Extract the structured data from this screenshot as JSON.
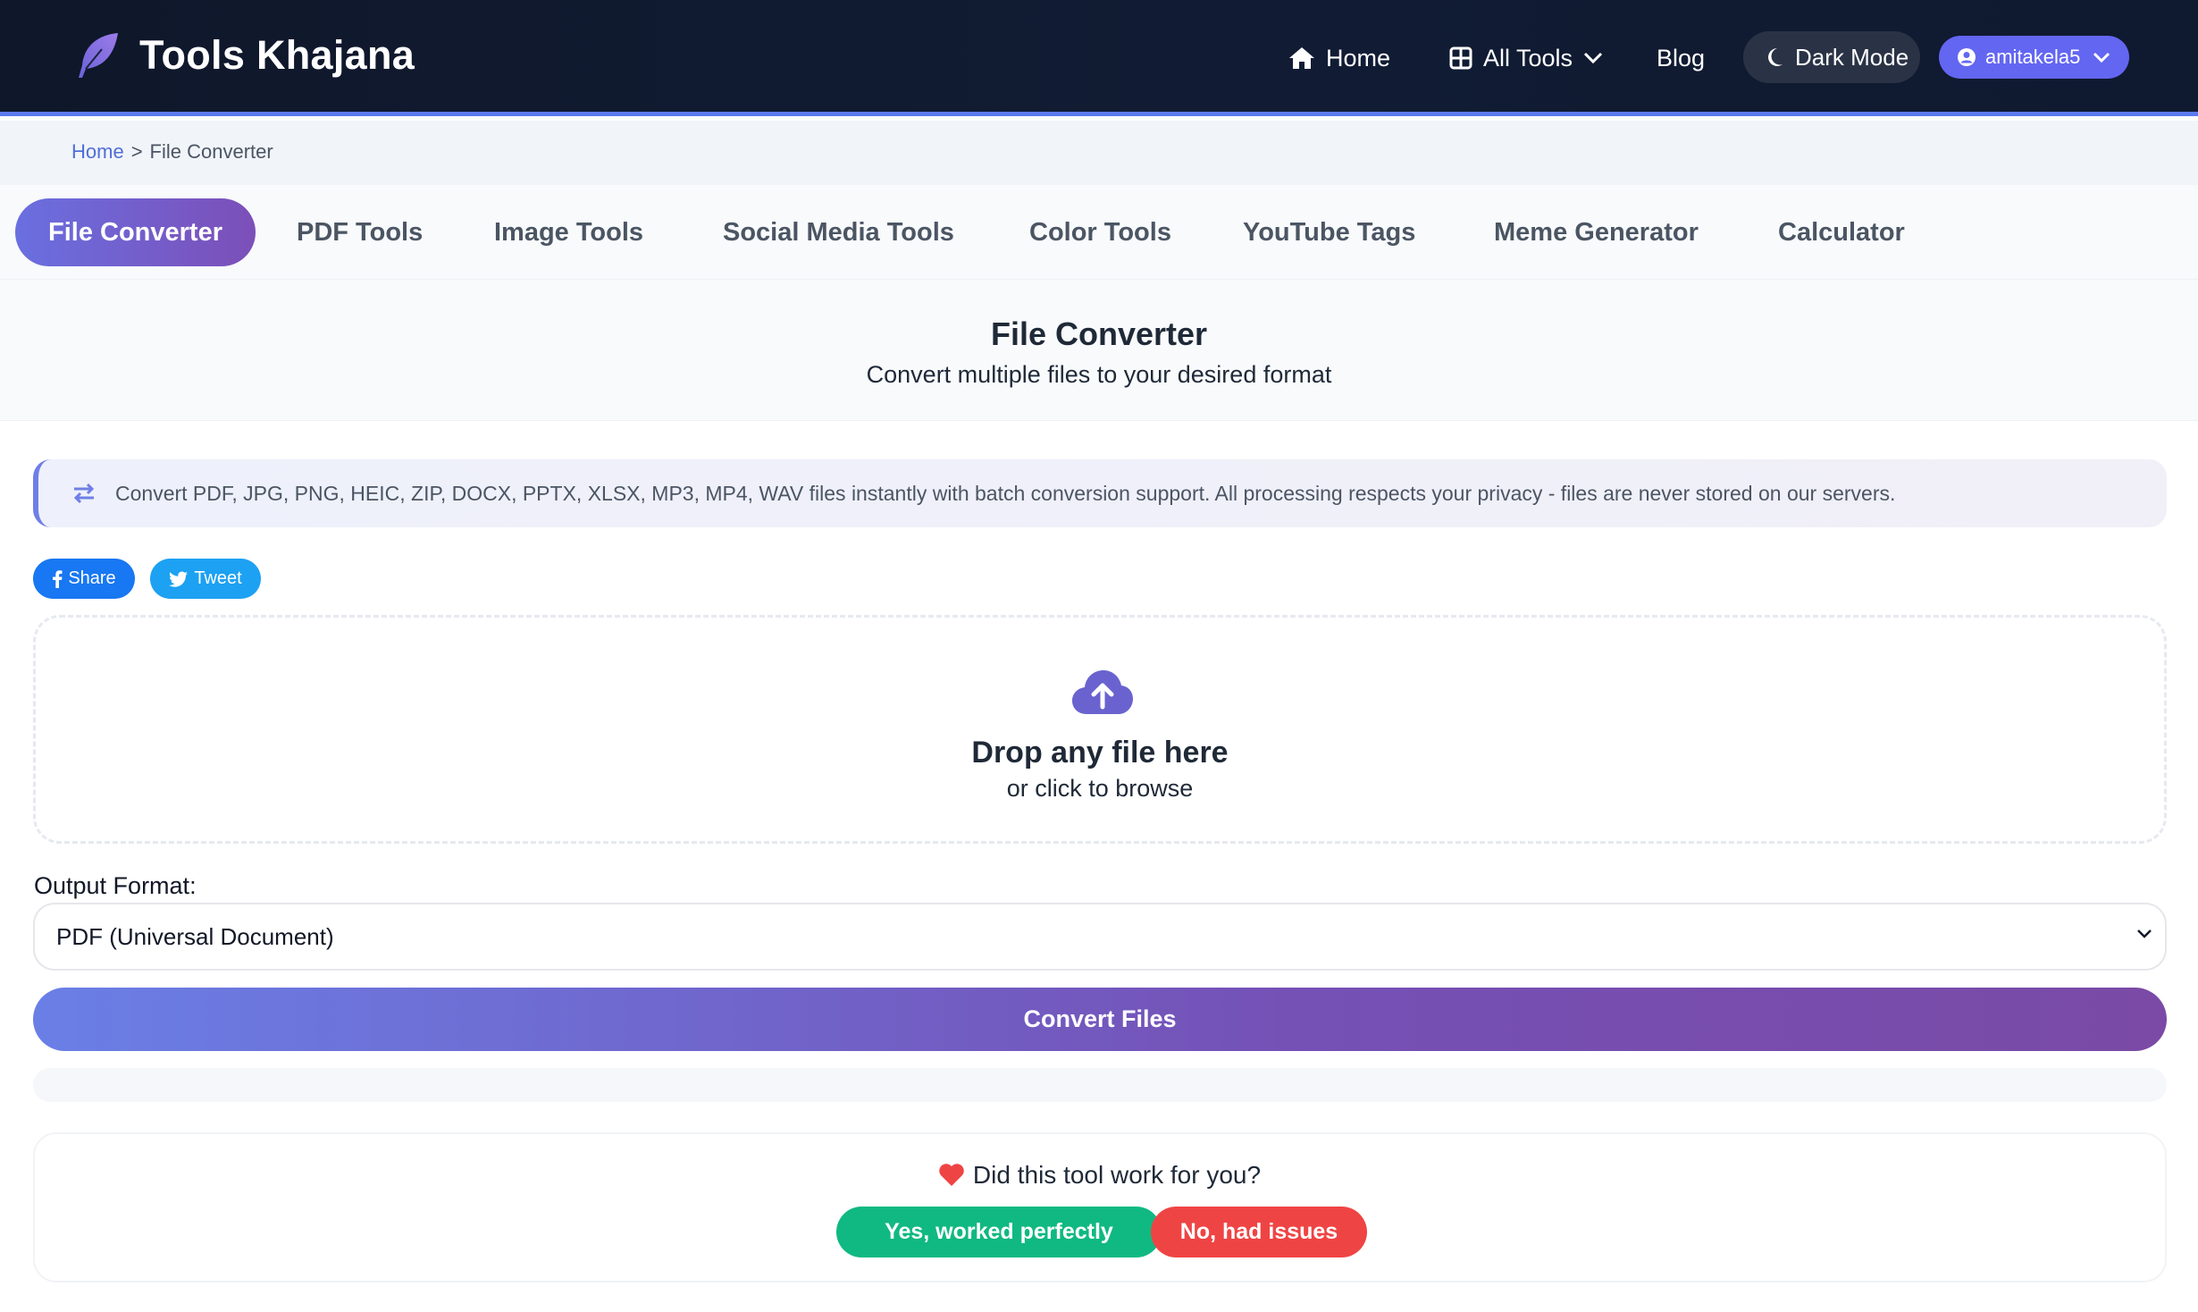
{
  "header": {
    "brand": "Tools Khajana",
    "nav": {
      "home": "Home",
      "all_tools": "All Tools",
      "blog": "Blog"
    },
    "dark_mode": "Dark Mode",
    "user": "amitakela5"
  },
  "breadcrumb": {
    "home": "Home",
    "separator": ">",
    "current": "File Converter"
  },
  "tabs": [
    {
      "label": "File Converter",
      "active": true
    },
    {
      "label": "PDF Tools"
    },
    {
      "label": "Image Tools"
    },
    {
      "label": "Social Media Tools"
    },
    {
      "label": "Color Tools"
    },
    {
      "label": "YouTube Tags"
    },
    {
      "label": "Meme Generator"
    },
    {
      "label": "Calculator"
    }
  ],
  "hero": {
    "title": "File Converter",
    "subtitle": "Convert multiple files to your desired format"
  },
  "info": "Convert PDF, JPG, PNG, HEIC, ZIP, DOCX, PPTX, XLSX, MP3, MP4, WAV files instantly with batch conversion support. All processing respects your privacy - files are never stored on our servers.",
  "share": {
    "facebook": "Share",
    "twitter": "Tweet"
  },
  "dropzone": {
    "title": "Drop any file here",
    "subtitle": "or click to browse"
  },
  "output": {
    "label": "Output Format:",
    "selected": "PDF (Universal Document)"
  },
  "convert_button": "Convert Files",
  "feedback": {
    "question": "Did this tool work for you?",
    "yes": "Yes, worked perfectly",
    "no": "No, had issues"
  },
  "colors": {
    "accent": "#6366f1",
    "nav_bg": "#0f172a",
    "success": "#10b981",
    "danger": "#ef4444"
  }
}
